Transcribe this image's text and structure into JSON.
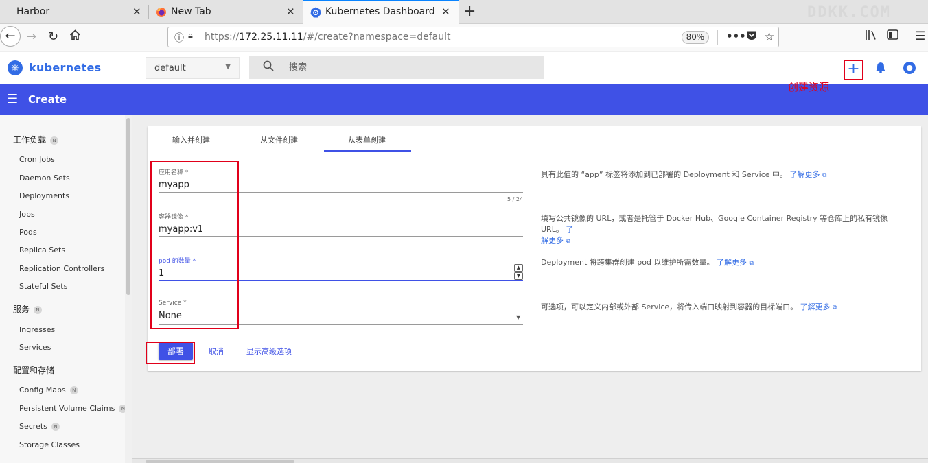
{
  "browser": {
    "tabs": [
      {
        "title": "Harbor",
        "icon": "page-icon"
      },
      {
        "title": "New Tab",
        "icon": "firefox-icon"
      },
      {
        "title": "Kubernetes Dashboard",
        "icon": "kubernetes-icon"
      }
    ],
    "close_glyph": "✕",
    "new_tab_glyph": "+",
    "watermark": "DDKK.COM",
    "url_prefix": "https://",
    "url_host": "172.25.11.11",
    "url_path": "/#/create?namespace=default",
    "zoom": "80%"
  },
  "app": {
    "brand": "kubernetes",
    "namespace": "default",
    "search_placeholder": "搜索",
    "create_annotation": "创建资源"
  },
  "toolbar": {
    "title": "Create"
  },
  "sidebar": {
    "sections": [
      {
        "label": "工作负载",
        "badge": "N",
        "items": [
          {
            "label": "Cron Jobs"
          },
          {
            "label": "Daemon Sets"
          },
          {
            "label": "Deployments"
          },
          {
            "label": "Jobs"
          },
          {
            "label": "Pods"
          },
          {
            "label": "Replica Sets"
          },
          {
            "label": "Replication Controllers"
          },
          {
            "label": "Stateful Sets"
          }
        ]
      },
      {
        "label": "服务",
        "badge": "N",
        "items": [
          {
            "label": "Ingresses"
          },
          {
            "label": "Services"
          }
        ]
      },
      {
        "label": "配置和存储",
        "items": [
          {
            "label": "Config Maps",
            "badge": "N"
          },
          {
            "label": "Persistent Volume Claims",
            "badge": "N"
          },
          {
            "label": "Secrets",
            "badge": "N"
          },
          {
            "label": "Storage Classes"
          }
        ]
      }
    ]
  },
  "create": {
    "tabs": [
      "输入并创建",
      "从文件创建",
      "从表单创建"
    ],
    "active_tab": "从表单创建",
    "fields": {
      "app_name": {
        "label": "应用名称 *",
        "value": "myapp",
        "counter": "5 / 24"
      },
      "image": {
        "label": "容器镜像 *",
        "value": "myapp:v1"
      },
      "pods": {
        "label": "pod 的数量 *",
        "value": "1"
      },
      "service": {
        "label": "Service *",
        "value": "None"
      }
    },
    "help": {
      "app_name": "具有此值的 “app” 标签将添加到已部署的 Deployment 和 Service 中。",
      "image": "填写公共镜像的 URL，或者是托管于 Docker Hub、Google Container Registry 等仓库上的私有镜像 URL。",
      "pods": "Deployment 将跨集群创建 pod 以维护所需数量。",
      "service": "可选项，可以定义内部或外部 Service，将传入端口映射到容器的目标端口。",
      "learn_more": "了解更多",
      "learn_more_split_a": "了",
      "learn_more_split_b": "解更多"
    },
    "buttons": {
      "deploy": "部署",
      "cancel": "取消",
      "advanced": "显示高级选项"
    }
  }
}
